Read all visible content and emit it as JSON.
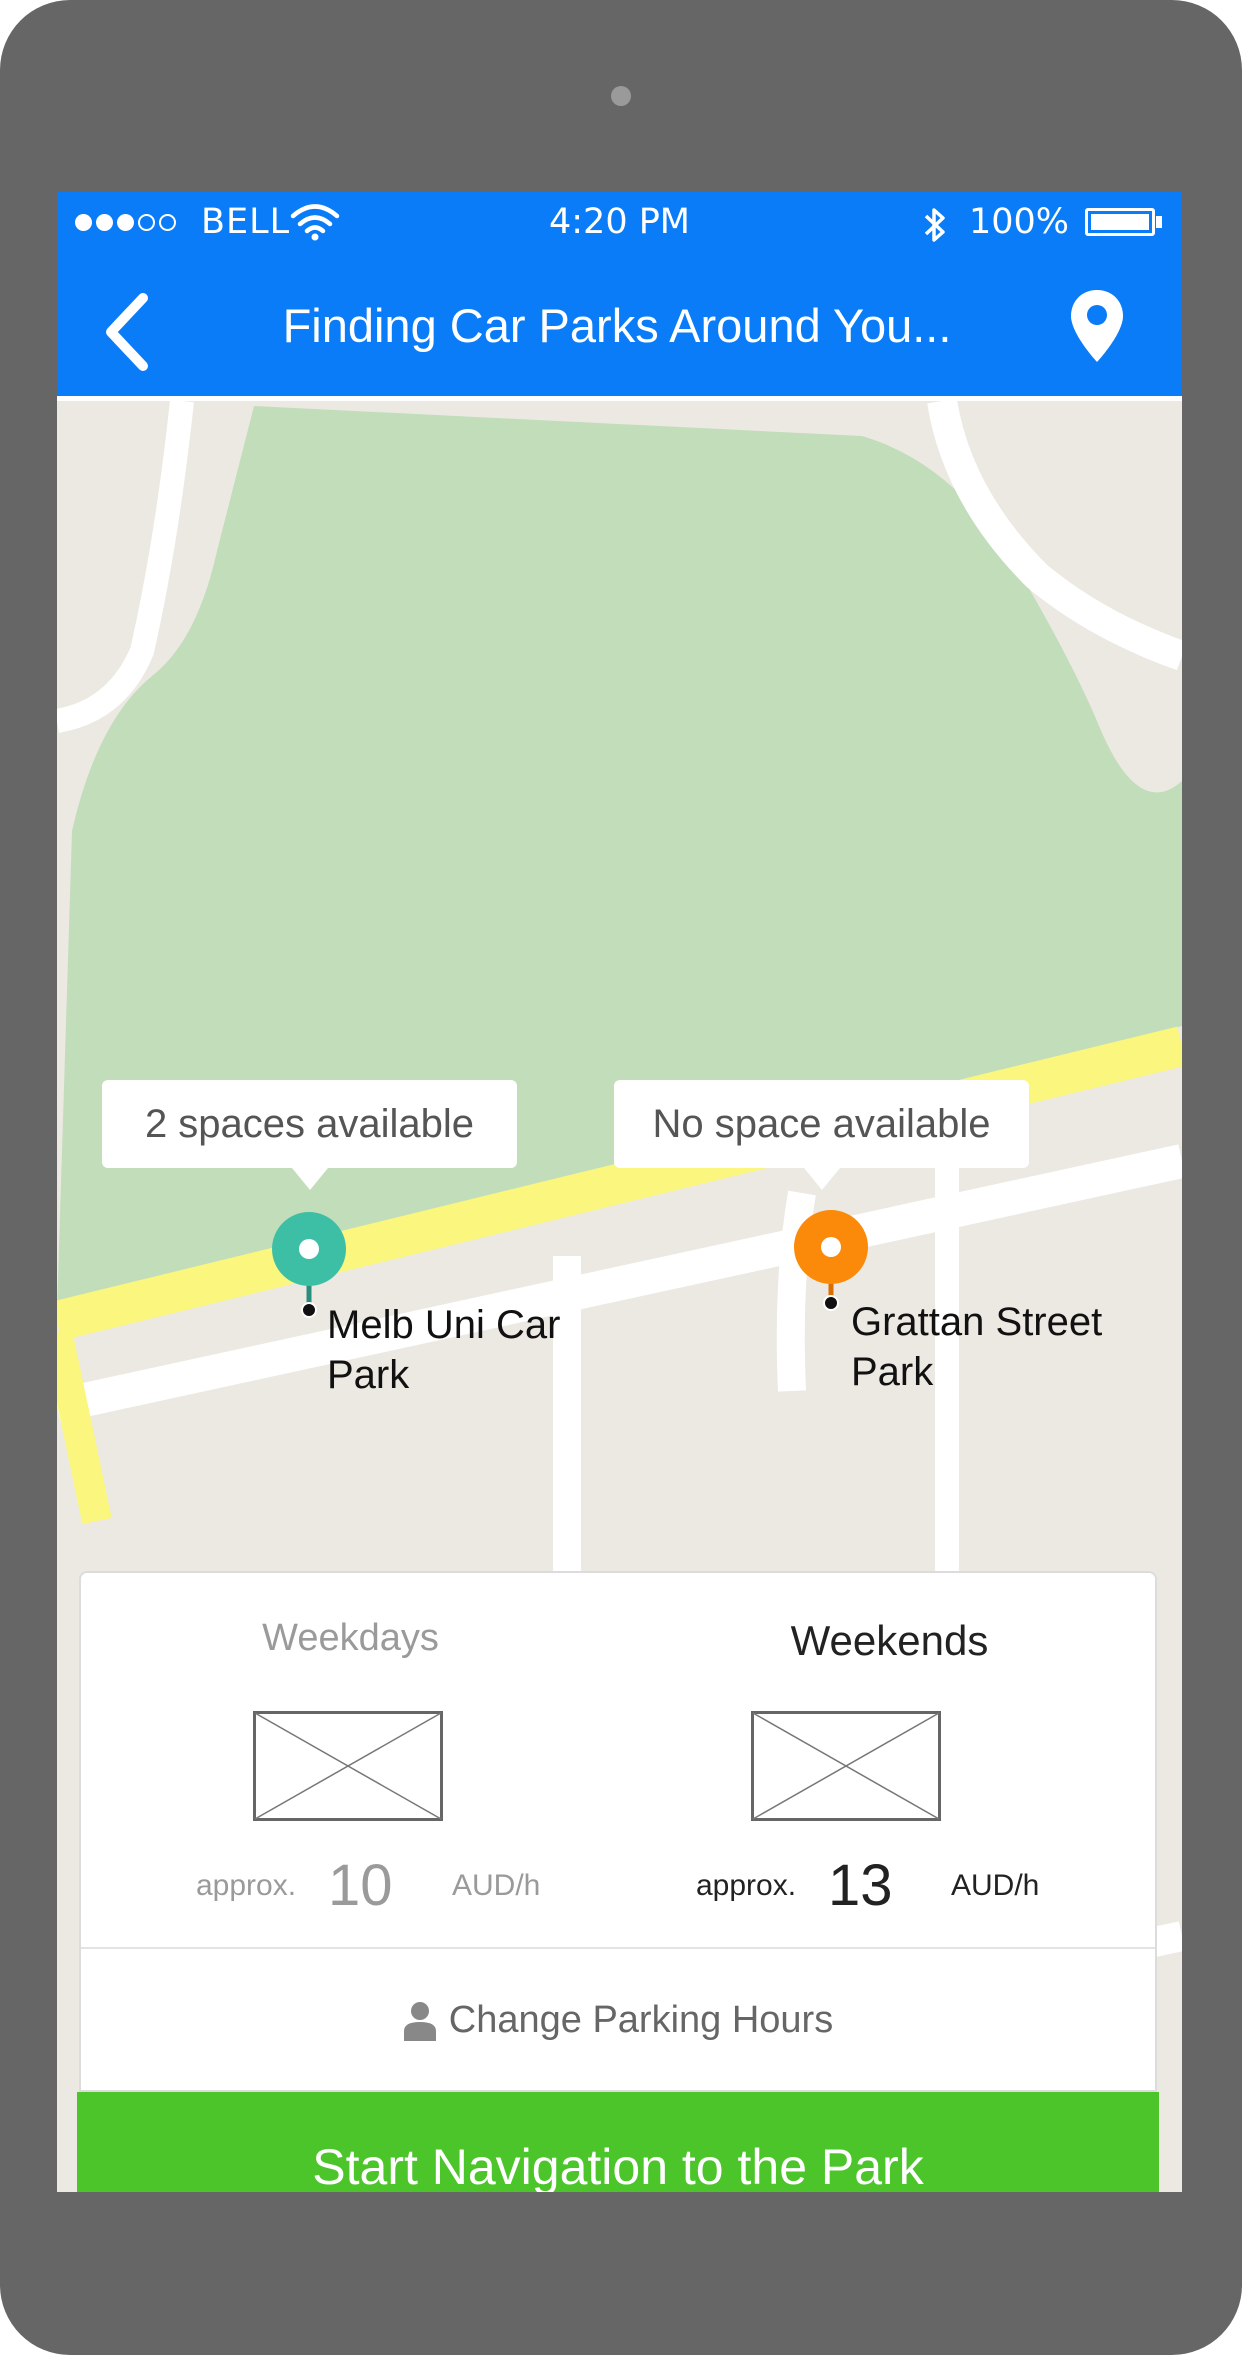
{
  "status_bar": {
    "carrier": "BELL",
    "time": "4:20 PM",
    "battery": "100%",
    "battery_level": 1.0,
    "signal_strength": 3,
    "signal_max": 5
  },
  "header": {
    "title": "Finding Car Parks Around You..."
  },
  "map": {
    "parks": [
      {
        "availability": "2 spaces available",
        "name_line1": "Melb Uni Car",
        "name_line2": "Park",
        "color": "#3dbfa6"
      },
      {
        "availability": "No space available",
        "name_line1": "Grattan Street",
        "name_line2": "Park",
        "color": "#fb8a0a"
      }
    ]
  },
  "pricing": {
    "weekdays": {
      "label": "Weekdays",
      "approx": "approx.",
      "price": "10",
      "unit": "AUD/h"
    },
    "weekends": {
      "label": "Weekends",
      "approx": "approx.",
      "price": "13",
      "unit": "AUD/h"
    }
  },
  "actions": {
    "change_hours": "Change Parking Hours",
    "start_navigation": "Start Navigation to the Park"
  },
  "colors": {
    "primary_blue": "#0a7cf8",
    "cta_green": "#4cc52b",
    "park_green": "#c2ddba",
    "main_road": "#fbf67d"
  }
}
